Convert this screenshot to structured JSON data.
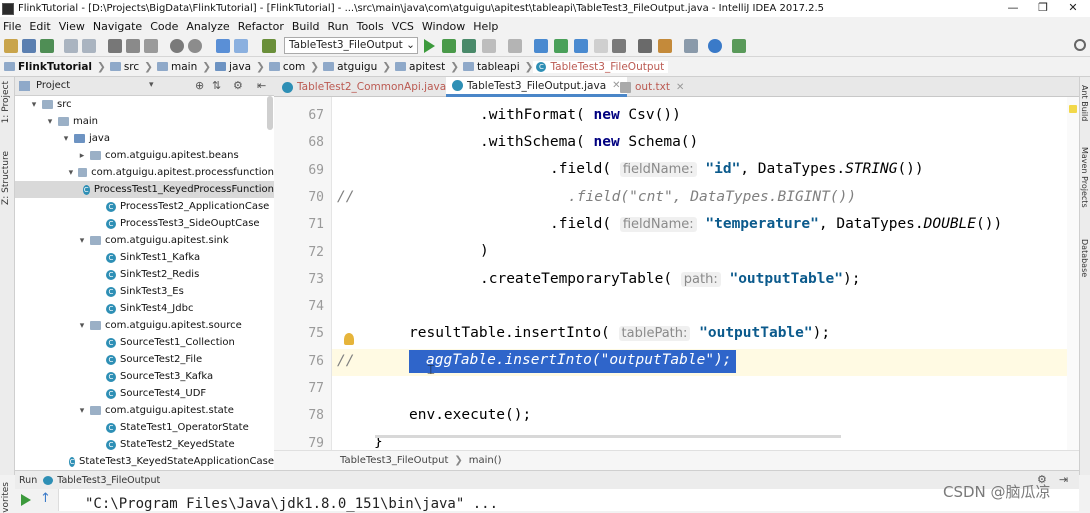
{
  "window": {
    "title": "FlinkTutorial - [D:\\Projects\\BigData\\FlinkTutorial] - [FlinkTutorial] - ...\\src\\main\\java\\com\\atguigu\\apitest\\tableapi\\TableTest3_FileOutput.java - IntelliJ IDEA 2017.2.5",
    "controls": [
      "—",
      "❐",
      "✕"
    ]
  },
  "menu": [
    "File",
    "Edit",
    "View",
    "Navigate",
    "Code",
    "Analyze",
    "Refactor",
    "Build",
    "Run",
    "Tools",
    "VCS",
    "Window",
    "Help"
  ],
  "toolbar": {
    "run_config": "TableTest3_FileOutput"
  },
  "breadcrumbs": [
    "FlinkTutorial",
    "src",
    "main",
    "java",
    "com",
    "atguigu",
    "apitest",
    "tableapi",
    "TableTest3_FileOutput"
  ],
  "left_strip": {
    "project": "1: Project",
    "structure": "Z: Structure",
    "favorites": "vorites"
  },
  "right_strip": {
    "ant": "Ant Build",
    "maven": "Maven Projects",
    "database": "Database"
  },
  "project_panel": {
    "title": "Project"
  },
  "tree": [
    {
      "label": "src",
      "kind": "folder",
      "depth": 1,
      "arrow": "▾"
    },
    {
      "label": "main",
      "kind": "folder",
      "depth": 2,
      "arrow": "▾"
    },
    {
      "label": "java",
      "kind": "folder-java",
      "depth": 3,
      "arrow": "▾"
    },
    {
      "label": "com.atguigu.apitest.beans",
      "kind": "package",
      "depth": 4,
      "arrow": "▸"
    },
    {
      "label": "com.atguigu.apitest.processfunction",
      "kind": "package",
      "depth": 4,
      "arrow": "▾"
    },
    {
      "label": "ProcessTest1_KeyedProcessFunction",
      "kind": "class",
      "depth": 5,
      "arrow": "",
      "selected": true
    },
    {
      "label": "ProcessTest2_ApplicationCase",
      "kind": "class",
      "depth": 5,
      "arrow": ""
    },
    {
      "label": "ProcessTest3_SideOuptCase",
      "kind": "class",
      "depth": 5,
      "arrow": ""
    },
    {
      "label": "com.atguigu.apitest.sink",
      "kind": "package",
      "depth": 4,
      "arrow": "▾"
    },
    {
      "label": "SinkTest1_Kafka",
      "kind": "class",
      "depth": 5,
      "arrow": ""
    },
    {
      "label": "SinkTest2_Redis",
      "kind": "class",
      "depth": 5,
      "arrow": ""
    },
    {
      "label": "SinkTest3_Es",
      "kind": "class",
      "depth": 5,
      "arrow": ""
    },
    {
      "label": "SinkTest4_Jdbc",
      "kind": "class",
      "depth": 5,
      "arrow": ""
    },
    {
      "label": "com.atguigu.apitest.source",
      "kind": "package",
      "depth": 4,
      "arrow": "▾"
    },
    {
      "label": "SourceTest1_Collection",
      "kind": "class",
      "depth": 5,
      "arrow": ""
    },
    {
      "label": "SourceTest2_File",
      "kind": "class",
      "depth": 5,
      "arrow": ""
    },
    {
      "label": "SourceTest3_Kafka",
      "kind": "class",
      "depth": 5,
      "arrow": ""
    },
    {
      "label": "SourceTest4_UDF",
      "kind": "class",
      "depth": 5,
      "arrow": ""
    },
    {
      "label": "com.atguigu.apitest.state",
      "kind": "package",
      "depth": 4,
      "arrow": "▾"
    },
    {
      "label": "StateTest1_OperatorState",
      "kind": "class",
      "depth": 5,
      "arrow": ""
    },
    {
      "label": "StateTest2_KeyedState",
      "kind": "class",
      "depth": 5,
      "arrow": ""
    },
    {
      "label": "StateTest3_KeyedStateApplicationCase",
      "kind": "class",
      "depth": 5,
      "arrow": ""
    }
  ],
  "editor_tabs": [
    {
      "label": "TableTest2_CommonApi.java",
      "active": false
    },
    {
      "label": "TableTest3_FileOutput.java",
      "active": true
    },
    {
      "label": "out.txt",
      "active": false
    }
  ],
  "code": {
    "line_numbers": [
      "67",
      "68",
      "69",
      "70",
      "71",
      "72",
      "73",
      "74",
      "75",
      "76",
      "77",
      "78",
      "79"
    ],
    "l67": {
      "a": ".withFormat( ",
      "kw": "new",
      "b": " Csv())"
    },
    "l68": {
      "a": ".withSchema( ",
      "kw": "new",
      "b": " Schema()"
    },
    "l69": {
      "a": ".field( ",
      "hint": "fieldName:",
      "str": "\"id\"",
      "b": ", DataTypes.",
      "it": "STRING",
      "c": "())"
    },
    "l70": {
      "comment": "//",
      "text": ".field(\"cnt\", DataTypes.BIGINT())"
    },
    "l71": {
      "a": ".field( ",
      "hint": "fieldName:",
      "str": "\"temperature\"",
      "b": ", DataTypes.",
      "it": "DOUBLE",
      "c": "())"
    },
    "l72": {
      "a": ")"
    },
    "l73": {
      "a": ".createTemporaryTable( ",
      "hint": "path:",
      "str": "\"outputTable\"",
      "b": ");"
    },
    "l75": {
      "a": "resultTable.insertInto( ",
      "hint": "tablePath:",
      "str": "\"outputTable\"",
      "b": ");"
    },
    "l76": {
      "comment": "//",
      "selected": "aggTable.insertInto(\"outputTable\");"
    },
    "l78": {
      "a": "env.execute();"
    },
    "l79": {
      "a": "}"
    }
  },
  "editor_breadcrumb": [
    "TableTest3_FileOutput",
    "main()"
  ],
  "run_panel": {
    "label": "Run",
    "config": "TableTest3_FileOutput",
    "console_line": "\"C:\\Program Files\\Java\\jdk1.8.0_151\\bin\\java\" ..."
  },
  "watermark": "CSDN @脑瓜凉"
}
